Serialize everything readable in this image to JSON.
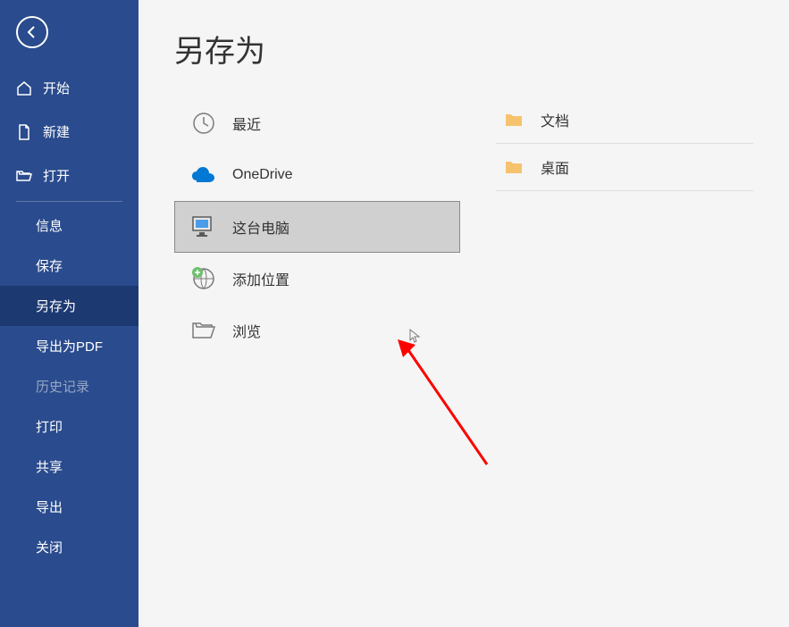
{
  "page_title": "另存为",
  "sidebar": {
    "items": [
      {
        "id": "home",
        "label": "开始",
        "icon": "home-icon"
      },
      {
        "id": "new",
        "label": "新建",
        "icon": "document-icon"
      },
      {
        "id": "open",
        "label": "打开",
        "icon": "open-folder-icon"
      },
      {
        "id": "info",
        "label": "信息"
      },
      {
        "id": "save",
        "label": "保存"
      },
      {
        "id": "saveas",
        "label": "另存为",
        "active": true
      },
      {
        "id": "exportpdf",
        "label": "导出为PDF"
      },
      {
        "id": "history",
        "label": "历史记录",
        "disabled": true
      },
      {
        "id": "print",
        "label": "打印"
      },
      {
        "id": "share",
        "label": "共享"
      },
      {
        "id": "export",
        "label": "导出"
      },
      {
        "id": "close",
        "label": "关闭"
      }
    ]
  },
  "locations": {
    "items": [
      {
        "id": "recent",
        "label": "最近",
        "icon": "clock-icon"
      },
      {
        "id": "onedrive",
        "label": "OneDrive",
        "icon": "onedrive-icon"
      },
      {
        "id": "thispc",
        "label": "这台电脑",
        "icon": "pc-icon",
        "selected": true
      },
      {
        "id": "addplace",
        "label": "添加位置",
        "icon": "add-location-icon"
      },
      {
        "id": "browse",
        "label": "浏览",
        "icon": "browse-folder-icon"
      }
    ]
  },
  "folders": {
    "items": [
      {
        "id": "documents",
        "label": "文档"
      },
      {
        "id": "desktop",
        "label": "桌面"
      }
    ]
  },
  "colors": {
    "sidebar_bg": "#2a4b8d",
    "sidebar_active": "#1d3971",
    "selection_bg": "#d0d0d0",
    "arrow": "#ff0000"
  }
}
